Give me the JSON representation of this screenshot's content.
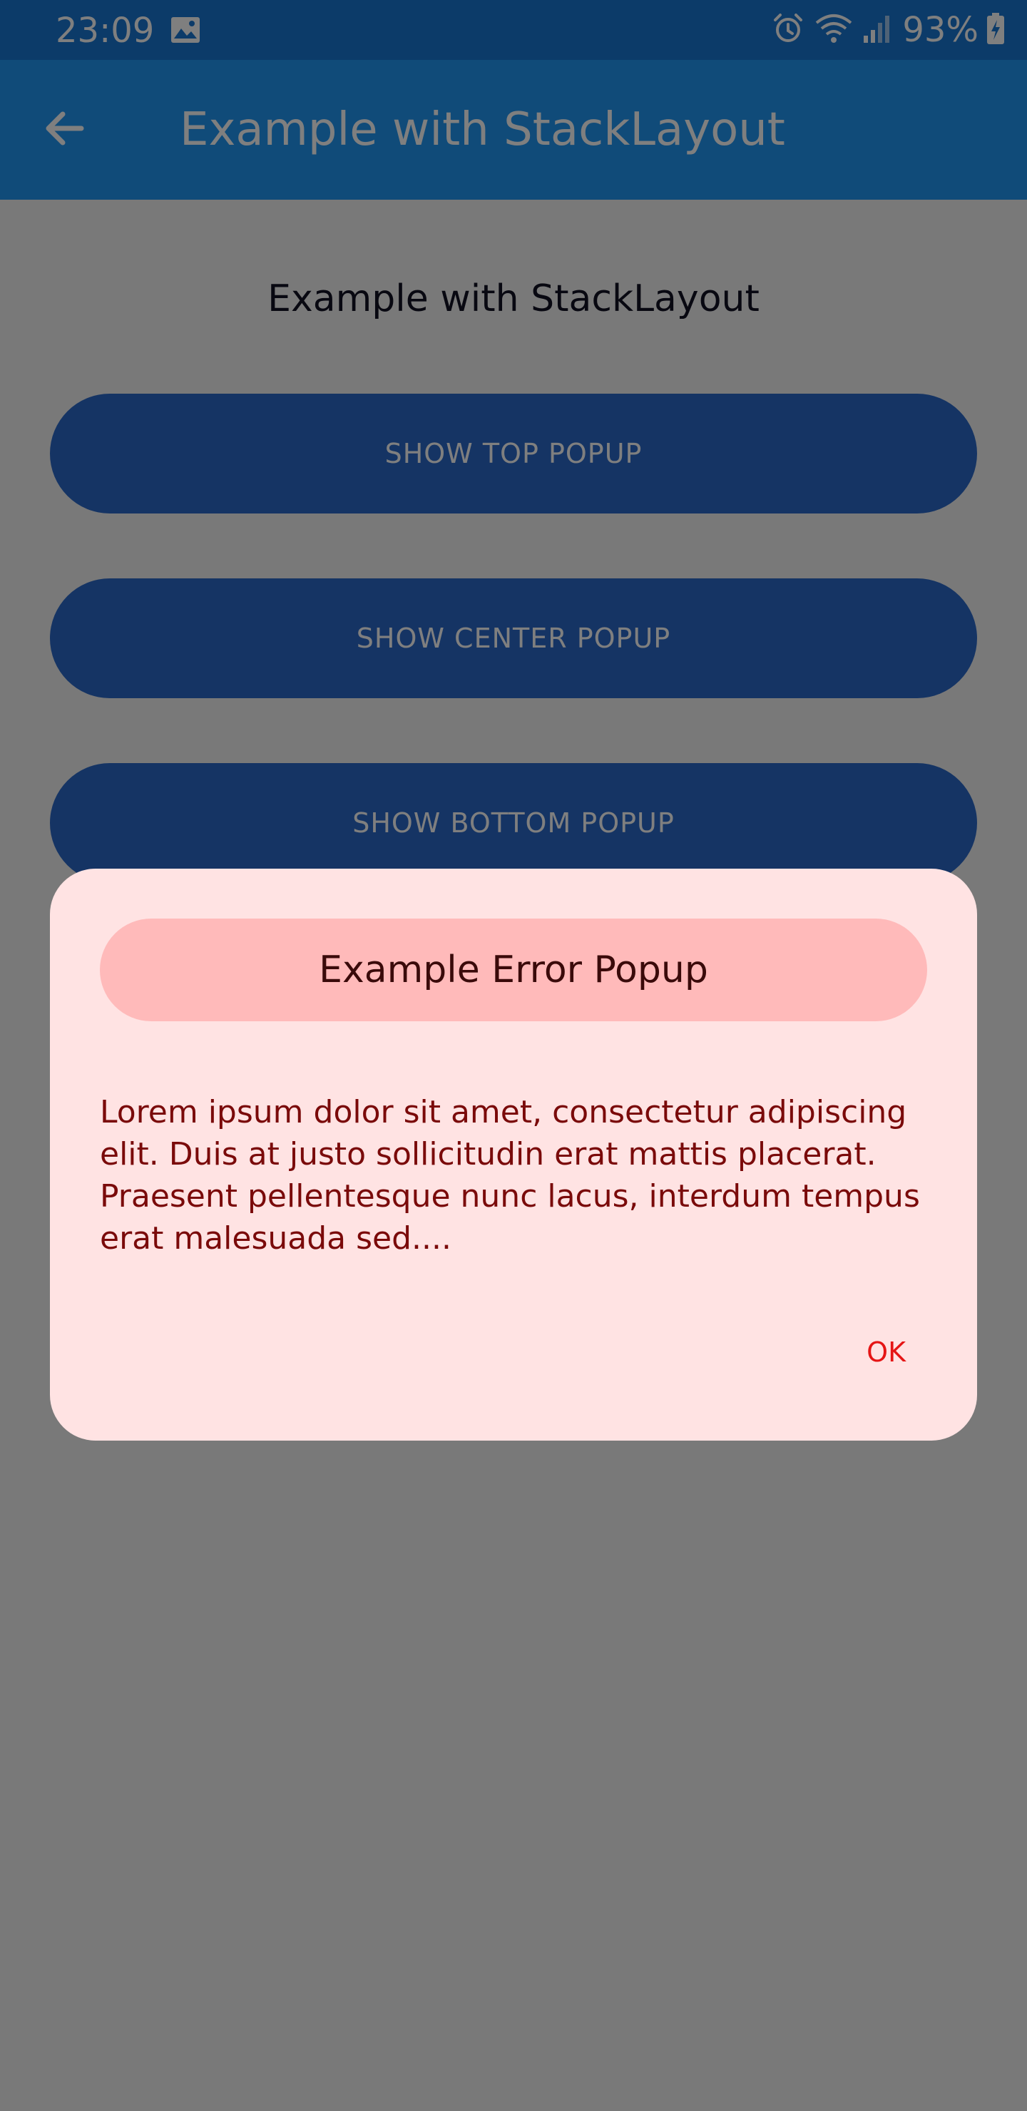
{
  "status_bar": {
    "time": "23:09",
    "battery_percent": "93%",
    "icons": [
      "image-icon",
      "alarm-icon",
      "wifi-icon",
      "signal-icon",
      "battery-charging-icon"
    ]
  },
  "app_bar": {
    "title": "Example with StackLayout",
    "back_icon": "arrow-back-icon"
  },
  "page": {
    "heading": "Example with StackLayout",
    "buttons": [
      {
        "label": "SHOW TOP POPUP"
      },
      {
        "label": "SHOW CENTER POPUP"
      },
      {
        "label": "SHOW BOTTOM POPUP"
      }
    ]
  },
  "popup": {
    "title": "Example Error Popup",
    "message": "Lorem ipsum dolor sit amet, consectetur adipiscing elit. Duis at justo sollicitudin erat mattis placerat. Praesent pellentesque nunc lacus, interdum tempus erat malesuada sed....",
    "ok_label": "OK"
  },
  "colors": {
    "status_bar": "#1976d2",
    "app_bar": "#2196f3",
    "button": "#2a68c8",
    "popup_background": "#ffe3e3",
    "popup_header": "#ffbaba",
    "popup_title": "#3a0a0a",
    "popup_text": "#7a0a0a",
    "ok_text": "#e51515",
    "scrim": "rgba(0,0,0,0.5)"
  }
}
